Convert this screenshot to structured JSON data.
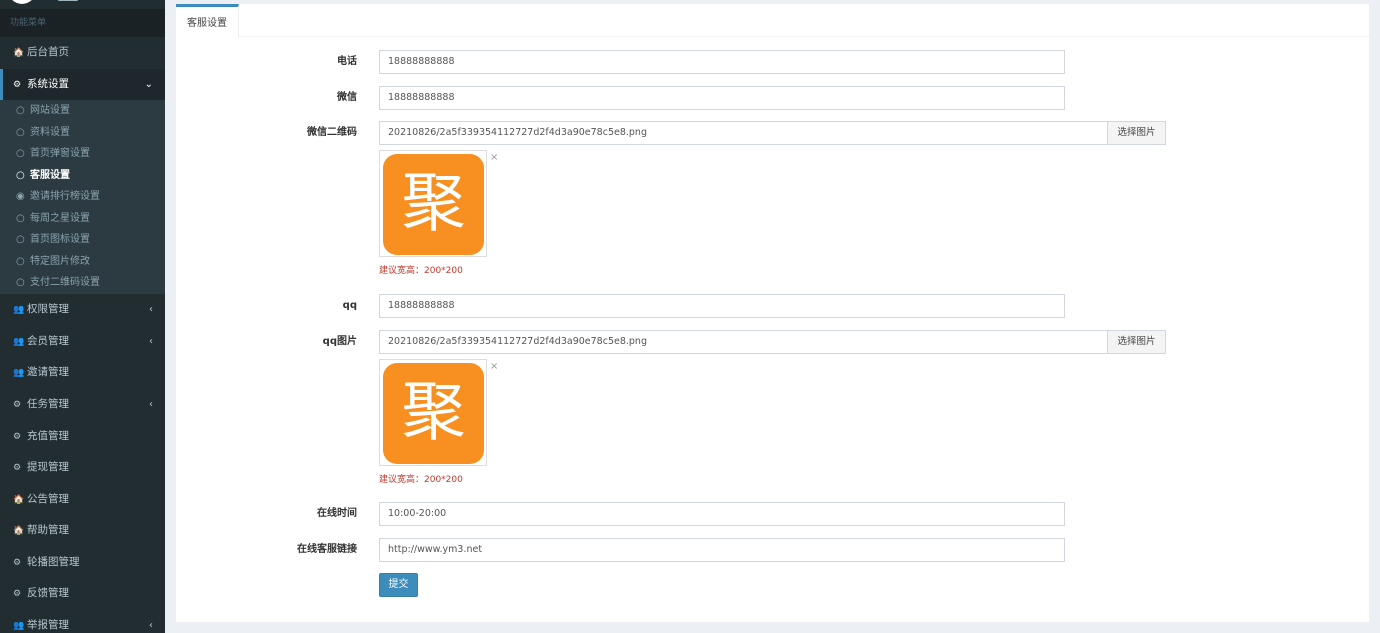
{
  "sidebar": {
    "header": "功能菜单",
    "items": [
      {
        "icon": "home-icon",
        "glyph": "🏠",
        "label": "后台首页"
      },
      {
        "icon": "dashboard-icon",
        "glyph": "⚙",
        "label": "系统设置"
      },
      {
        "icon": "users-icon",
        "glyph": "👥",
        "label": "权限管理"
      },
      {
        "icon": "users-icon",
        "glyph": "👥",
        "label": "会员管理"
      },
      {
        "icon": "users-icon",
        "glyph": "👥",
        "label": "邀请管理"
      },
      {
        "icon": "dashboard-icon",
        "glyph": "⚙",
        "label": "任务管理"
      },
      {
        "icon": "dashboard-icon",
        "glyph": "⚙",
        "label": "充值管理"
      },
      {
        "icon": "dashboard-icon",
        "glyph": "⚙",
        "label": "提现管理"
      },
      {
        "icon": "home-icon",
        "glyph": "🏠",
        "label": "公告管理"
      },
      {
        "icon": "home-icon",
        "glyph": "🏠",
        "label": "帮助管理"
      },
      {
        "icon": "dashboard-icon",
        "glyph": "⚙",
        "label": "轮播图管理"
      },
      {
        "icon": "dashboard-icon",
        "glyph": "⚙",
        "label": "反馈管理"
      },
      {
        "icon": "users-icon",
        "glyph": "👥",
        "label": "举报管理"
      }
    ],
    "submenu": [
      {
        "glyph": "○",
        "label": "网站设置"
      },
      {
        "glyph": "○",
        "label": "资料设置"
      },
      {
        "glyph": "○",
        "label": "首页弹窗设置"
      },
      {
        "glyph": "○",
        "label": "客服设置"
      },
      {
        "glyph": "◉",
        "label": "邀请排行榜设置"
      },
      {
        "glyph": "○",
        "label": "每周之星设置"
      },
      {
        "glyph": "○",
        "label": "首页图标设置"
      },
      {
        "glyph": "○",
        "label": "特定图片修改"
      },
      {
        "glyph": "○",
        "label": "支付二维码设置"
      }
    ],
    "chevron_open": "⌄",
    "chevron_closed": "‹"
  },
  "tab": {
    "label": "客服设置"
  },
  "form": {
    "phone": {
      "label": "电话",
      "value": "18888888888"
    },
    "wechat": {
      "label": "微信",
      "value": "18888888888"
    },
    "wechat_qr": {
      "label": "微信二维码",
      "value": "20210826/2a5f339354112727d2f4d3a90e78c5e8.png",
      "button": "选择图片",
      "hint": "建议宽高：200*200",
      "image_char": "聚"
    },
    "qq": {
      "label": "qq",
      "value": "18888888888"
    },
    "qq_image": {
      "label": "qq图片",
      "value": "20210826/2a5f339354112727d2f4d3a90e78c5e8.png",
      "button": "选择图片",
      "hint": "建议宽高：200*200",
      "image_char": "聚"
    },
    "online_time": {
      "label": "在线时间",
      "value": "10:00-20:00"
    },
    "service_link": {
      "label": "在线客服链接",
      "value": "http://www.ym3.net"
    },
    "remove_glyph": "×",
    "submit": "提交"
  },
  "colors": {
    "sidebar": "#222d32",
    "accent": "#3c8dbc",
    "hint": "#c0392b",
    "image": "#f79020"
  }
}
